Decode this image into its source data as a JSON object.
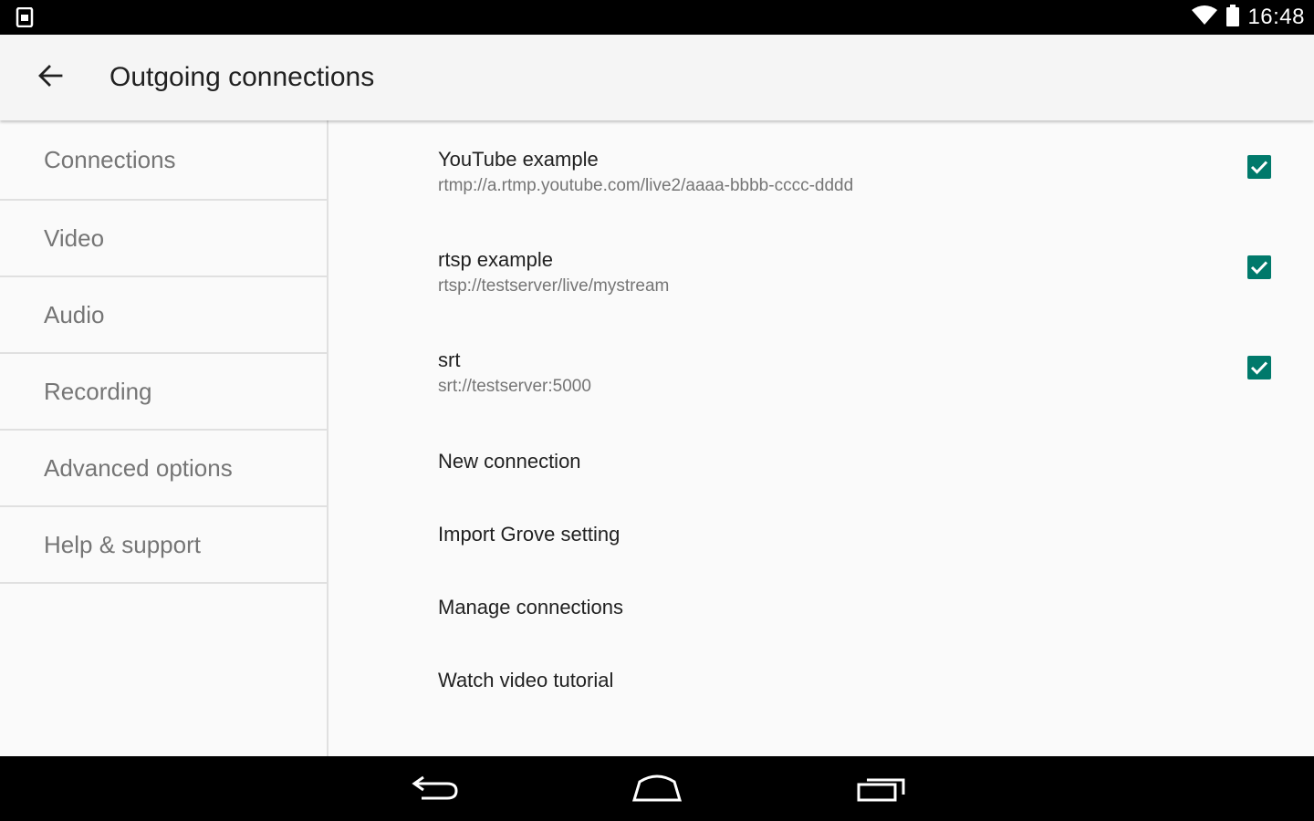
{
  "status_bar": {
    "time": "16:48",
    "icons": [
      "sim-icon",
      "wifi-icon",
      "battery-icon"
    ]
  },
  "app_bar": {
    "title": "Outgoing connections",
    "back_icon": "back-arrow-icon"
  },
  "sidebar": {
    "items": [
      {
        "label": "Connections"
      },
      {
        "label": "Video"
      },
      {
        "label": "Audio"
      },
      {
        "label": "Recording"
      },
      {
        "label": "Advanced options"
      },
      {
        "label": "Help & support"
      }
    ]
  },
  "connections": [
    {
      "name": "YouTube example",
      "url": "rtmp://a.rtmp.youtube.com/live2/aaaa-bbbb-cccc-dddd",
      "checked": true
    },
    {
      "name": "rtsp example",
      "url": "rtsp://testserver/live/mystream",
      "checked": true
    },
    {
      "name": "srt",
      "url": "srt://testserver:5000",
      "checked": true
    }
  ],
  "actions": [
    {
      "label": "New connection"
    },
    {
      "label": "Import Grove setting"
    },
    {
      "label": "Manage connections"
    },
    {
      "label": "Watch video tutorial"
    }
  ],
  "nav_bar": {
    "icons": [
      "back-nav-icon",
      "home-nav-icon",
      "recents-nav-icon"
    ]
  },
  "colors": {
    "accent": "#00796b",
    "status_bar": "#000000",
    "app_bar": "#f5f5f5",
    "background": "#fafafa",
    "divider": "#e0e0e0",
    "secondary_text": "#757575"
  }
}
